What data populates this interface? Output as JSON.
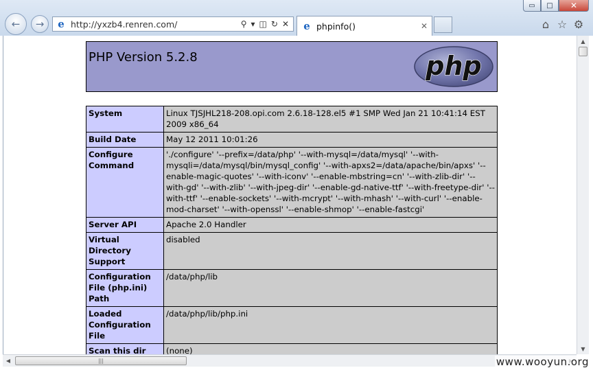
{
  "window": {
    "address_bar": {
      "url": "http://yxzb4.renren.com/"
    },
    "tabs": [
      {
        "title": "phpinfo()"
      }
    ],
    "controls": {
      "minimize": "▭",
      "maximize": "□",
      "close": "✕"
    }
  },
  "header": {
    "title": "PHP Version 5.2.8",
    "logo_text": "php"
  },
  "info_table": {
    "rows": [
      {
        "label": "System",
        "value": "Linux TJSJHL218-208.opi.com 2.6.18-128.el5 #1 SMP Wed Jan 21 10:41:14 EST 2009 x86_64"
      },
      {
        "label": "Build Date",
        "value": "May 12 2011 10:01:26"
      },
      {
        "label": "Configure Command",
        "value": "'./configure' '--prefix=/data/php' '--with-mysql=/data/mysql' '--with-mysqli=/data/mysql/bin/mysql_config' '--with-apxs2=/data/apache/bin/apxs' '--enable-magic-quotes' '--with-iconv' '--enable-mbstring=cn' '--with-zlib-dir' '--with-gd' '--with-zlib' '--with-jpeg-dir' '--enable-gd-native-ttf' '--with-freetype-dir' '--with-ttf' '--enable-sockets' '--with-mcrypt' '--with-mhash' '--with-curl' '--enable-mod-charset' '--with-openssl' '--enable-shmop' '--enable-fastcgi'"
      },
      {
        "label": "Server API",
        "value": "Apache 2.0 Handler"
      },
      {
        "label": "Virtual Directory Support",
        "value": "disabled"
      },
      {
        "label": "Configuration File (php.ini) Path",
        "value": "/data/php/lib"
      },
      {
        "label": "Loaded Configuration File",
        "value": "/data/php/lib/php.ini"
      },
      {
        "label": "Scan this dir for additional .ini files",
        "value": "(none)"
      }
    ]
  },
  "watermark": "www.wooyun.org",
  "colors": {
    "header_bg": "#9999cc",
    "label_bg": "#ccccff",
    "value_bg": "#cccccc"
  }
}
